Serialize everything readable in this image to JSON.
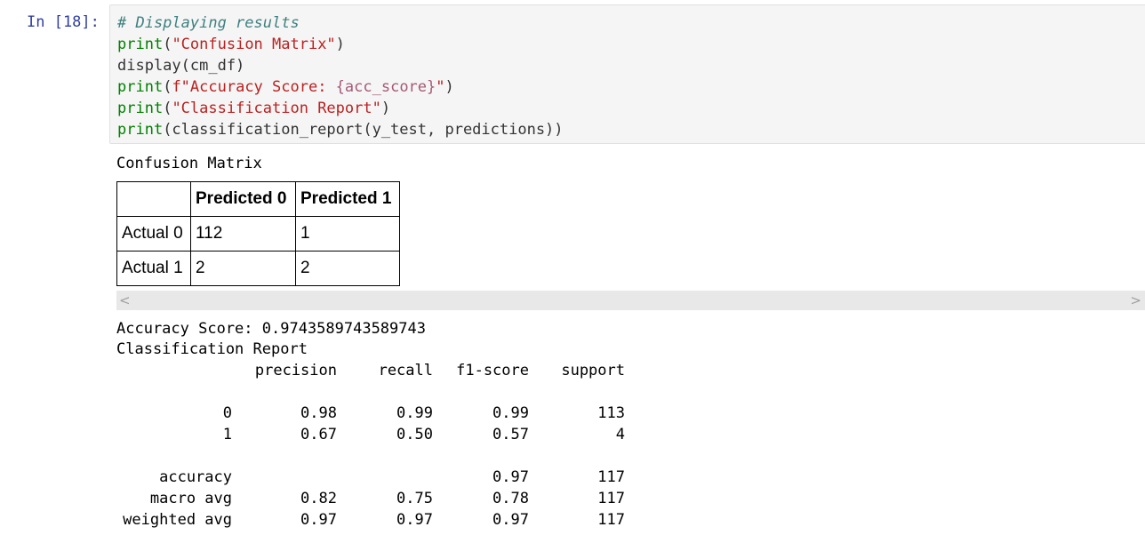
{
  "cell": {
    "prompt": "In [18]:",
    "code": {
      "line1": "# Displaying results",
      "line2_fn": "print",
      "line2_open": "(",
      "line2_str": "\"Confusion Matrix\"",
      "line2_close": ")",
      "line3": "display(cm_df)",
      "line4_fn": "print",
      "line4_open": "(",
      "line4_str_a": "f\"Accuracy Score: ",
      "line4_interp": "{acc_score}",
      "line4_str_b": "\"",
      "line4_close": ")",
      "line5_fn": "print",
      "line5_open": "(",
      "line5_str": "\"Classification Report\"",
      "line5_close": ")",
      "line6_fn": "print",
      "line6_rest": "(classification_report(y_test, predictions))"
    }
  },
  "output": {
    "confusion_title": "Confusion Matrix",
    "table": {
      "headers": [
        "",
        "Predicted 0",
        "Predicted 1"
      ],
      "rows": [
        [
          "Actual 0",
          "112",
          "1"
        ],
        [
          "Actual 1",
          "2",
          "2"
        ]
      ]
    },
    "scroll_left": "<",
    "scroll_right": ">",
    "accuracy_line": "Accuracy Score: 0.9743589743589743",
    "report_title": "Classification Report",
    "report": {
      "columns": [
        "precision",
        "recall",
        "f1-score",
        "support"
      ],
      "rows": [
        {
          "label": "0",
          "precision": "0.98",
          "recall": "0.99",
          "f1": "0.99",
          "support": "113"
        },
        {
          "label": "1",
          "precision": "0.67",
          "recall": "0.50",
          "f1": "0.57",
          "support": "4"
        },
        {
          "label": "accuracy",
          "precision": "",
          "recall": "",
          "f1": "0.97",
          "support": "117"
        },
        {
          "label": "macro avg",
          "precision": "0.82",
          "recall": "0.75",
          "f1": "0.78",
          "support": "117"
        },
        {
          "label": "weighted avg",
          "precision": "0.97",
          "recall": "0.97",
          "f1": "0.97",
          "support": "117"
        }
      ]
    }
  }
}
